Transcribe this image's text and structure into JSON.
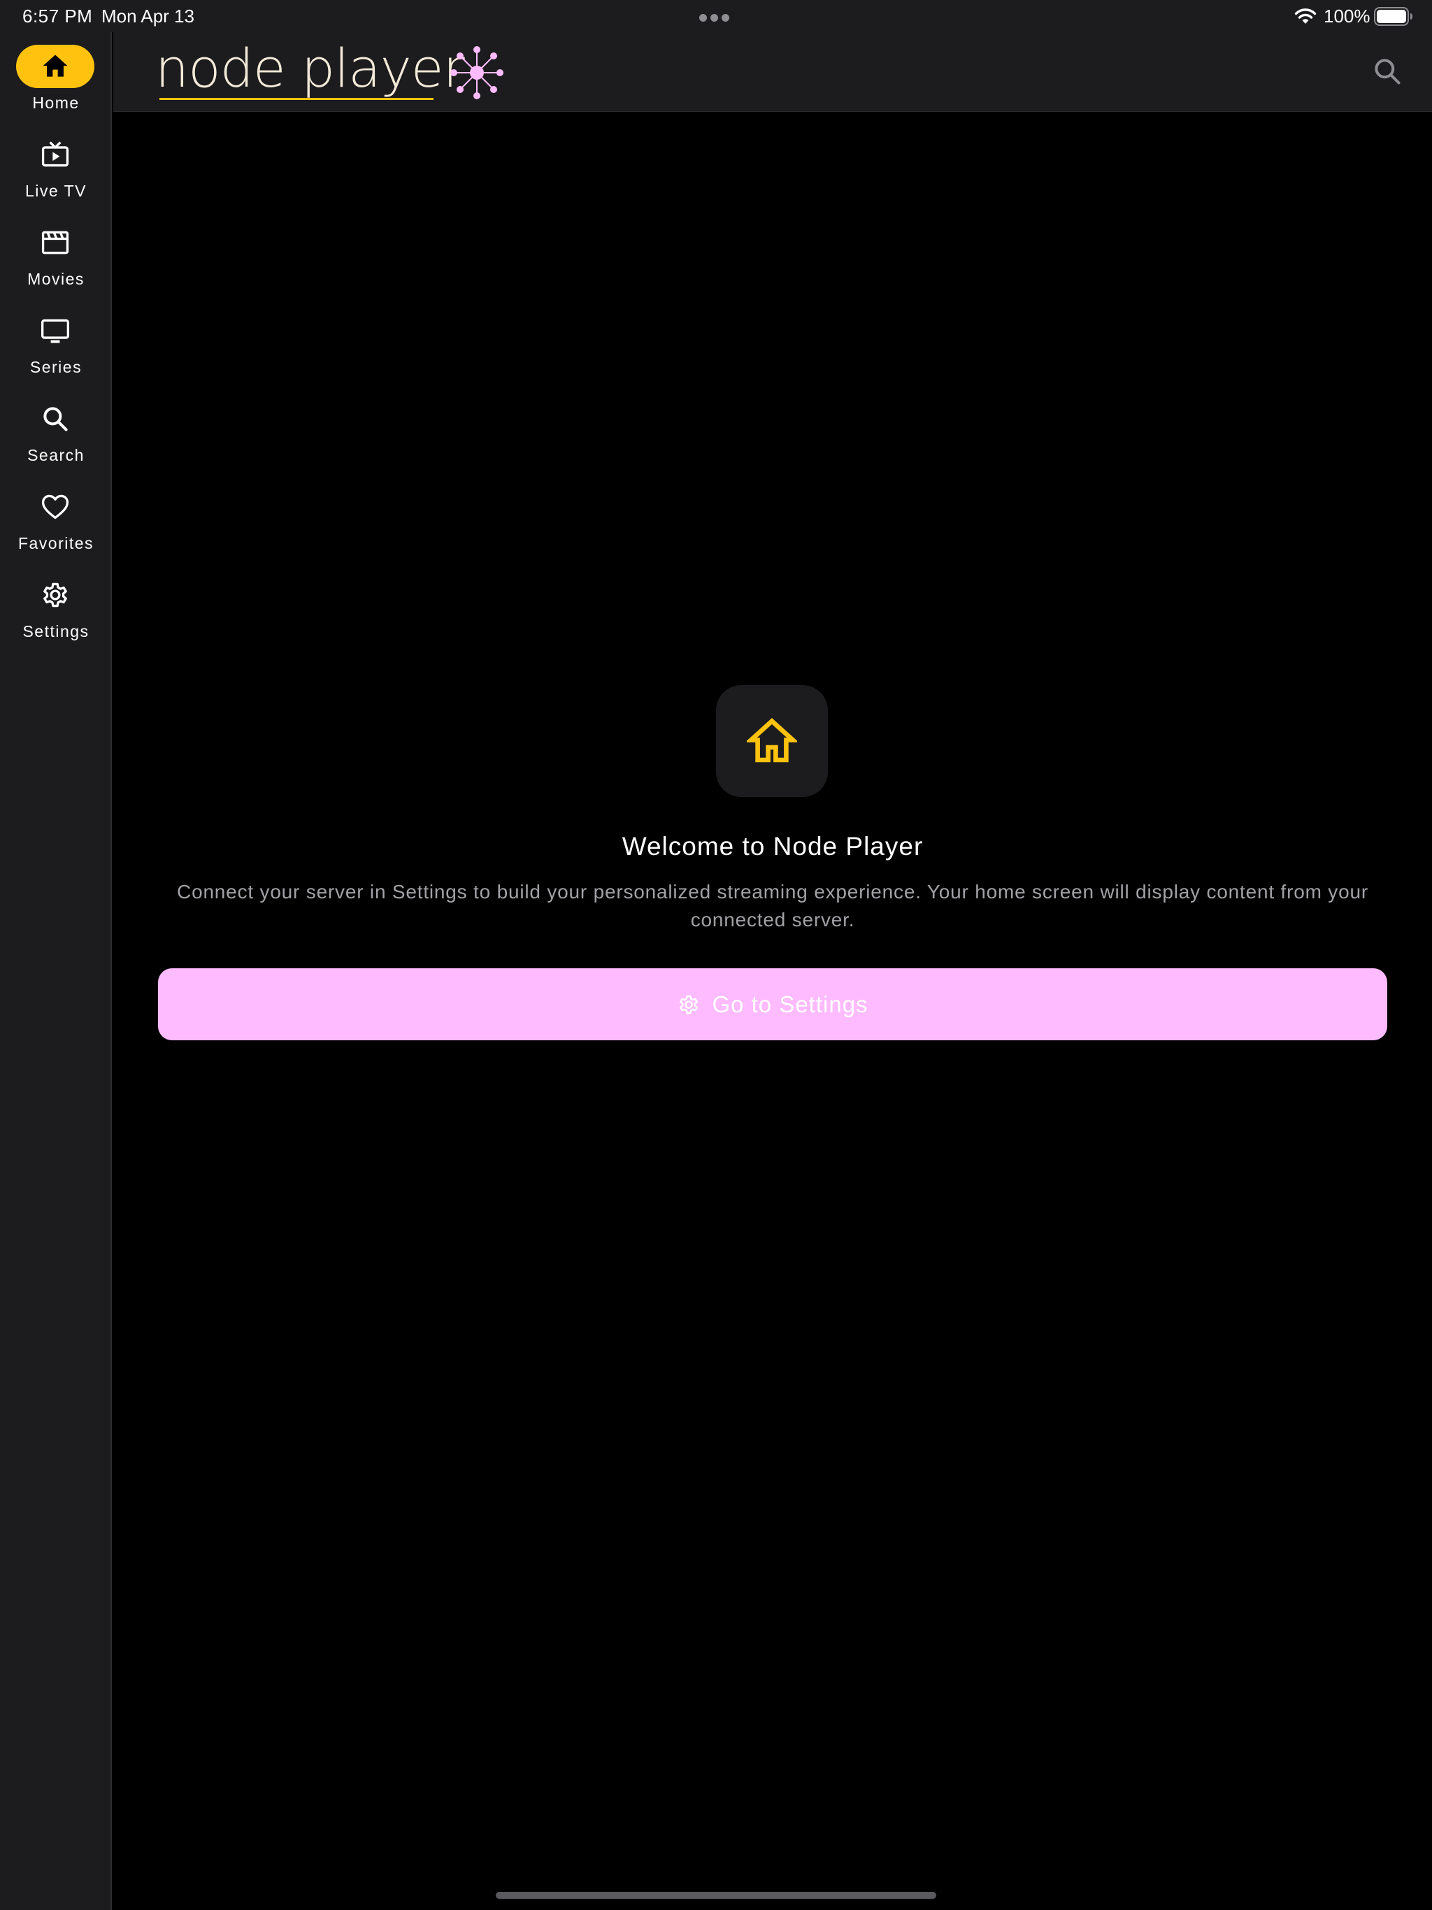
{
  "status_bar": {
    "time": "6:57 PM",
    "date": "Mon Apr 13",
    "battery": "100%",
    "wifi_icon": "wifi-icon",
    "battery_icon": "battery-icon"
  },
  "sidebar": {
    "items": [
      {
        "label": "Home",
        "icon": "home-icon",
        "active": true
      },
      {
        "label": "Live TV",
        "icon": "tv-play-icon",
        "active": false
      },
      {
        "label": "Movies",
        "icon": "clapperboard-icon",
        "active": false
      },
      {
        "label": "Series",
        "icon": "monitor-icon",
        "active": false
      },
      {
        "label": "Search",
        "icon": "search-icon",
        "active": false
      },
      {
        "label": "Favorites",
        "icon": "heart-icon",
        "active": false
      },
      {
        "label": "Settings",
        "icon": "gear-icon",
        "active": false
      }
    ]
  },
  "header": {
    "logo_text": "node player",
    "search_icon": "search-icon"
  },
  "main": {
    "icon": "home-outline-icon",
    "title": "Welcome to Node Player",
    "description": "Connect your server in Settings to build your personalized streaming experience. Your home screen will display content from your connected server.",
    "button_label": "Go to Settings",
    "button_icon": "gear-icon"
  },
  "colors": {
    "accent_yellow": "#ffc20e",
    "accent_pink": "#ffbbff",
    "background": "#000000",
    "surface": "#1c1c1e",
    "muted_text": "#a1a1a6"
  }
}
